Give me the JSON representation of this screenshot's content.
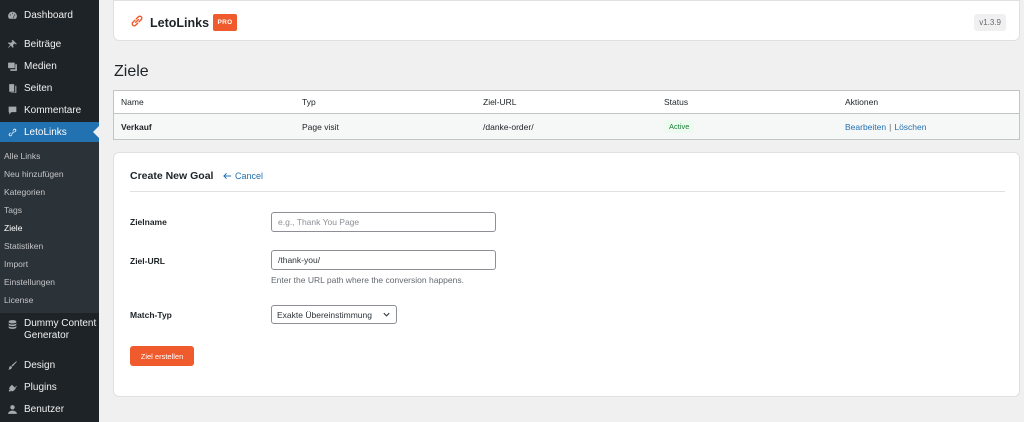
{
  "sidebar": {
    "items": [
      {
        "label": "Dashboard",
        "icon": "dashboard-icon"
      },
      {
        "label": "Beiträge",
        "icon": "pin-icon"
      },
      {
        "label": "Medien",
        "icon": "media-icon"
      },
      {
        "label": "Seiten",
        "icon": "pages-icon"
      },
      {
        "label": "Kommentare",
        "icon": "comment-icon"
      },
      {
        "label": "LetoLinks",
        "icon": "link-icon"
      },
      {
        "label": "Dummy Content Generator",
        "icon": "database-icon"
      },
      {
        "label": "Design",
        "icon": "brush-icon"
      },
      {
        "label": "Plugins",
        "icon": "plug-icon"
      },
      {
        "label": "Benutzer",
        "icon": "user-icon"
      }
    ],
    "submenu": [
      "Alle Links",
      "Neu hinzufügen",
      "Kategorien",
      "Tags",
      "Ziele",
      "Statistiken",
      "Import",
      "Einstellungen",
      "License"
    ],
    "dummy_line1": "Dummy Content",
    "dummy_line2": "Generator"
  },
  "header": {
    "brand": "LetoLinks",
    "badge": "PRO",
    "version": "v1.3.9"
  },
  "page_title": "Ziele",
  "table": {
    "columns": [
      "Name",
      "Typ",
      "Ziel-URL",
      "Status",
      "Aktionen"
    ],
    "rows": [
      {
        "name": "Verkauf",
        "type": "Page visit",
        "url": "/danke-order/",
        "status": "Active",
        "edit": "Bearbeiten",
        "sep": "|",
        "delete": "Löschen"
      }
    ]
  },
  "form": {
    "title": "Create New Goal",
    "cancel": "Cancel",
    "name_label": "Zielname",
    "name_placeholder": "e.g., Thank You Page",
    "url_label": "Ziel-URL",
    "url_value": "/thank-you/",
    "url_hint": "Enter the URL path where the conversion happens.",
    "match_label": "Match-Typ",
    "match_value": "Exakte Übereinstimmung",
    "submit": "Ziel erstellen"
  },
  "colors": {
    "accent": "#ef5b2c",
    "wp_blue": "#2271b1",
    "sidebar_bg": "#1d2327",
    "active_status": "#1a7f37"
  }
}
